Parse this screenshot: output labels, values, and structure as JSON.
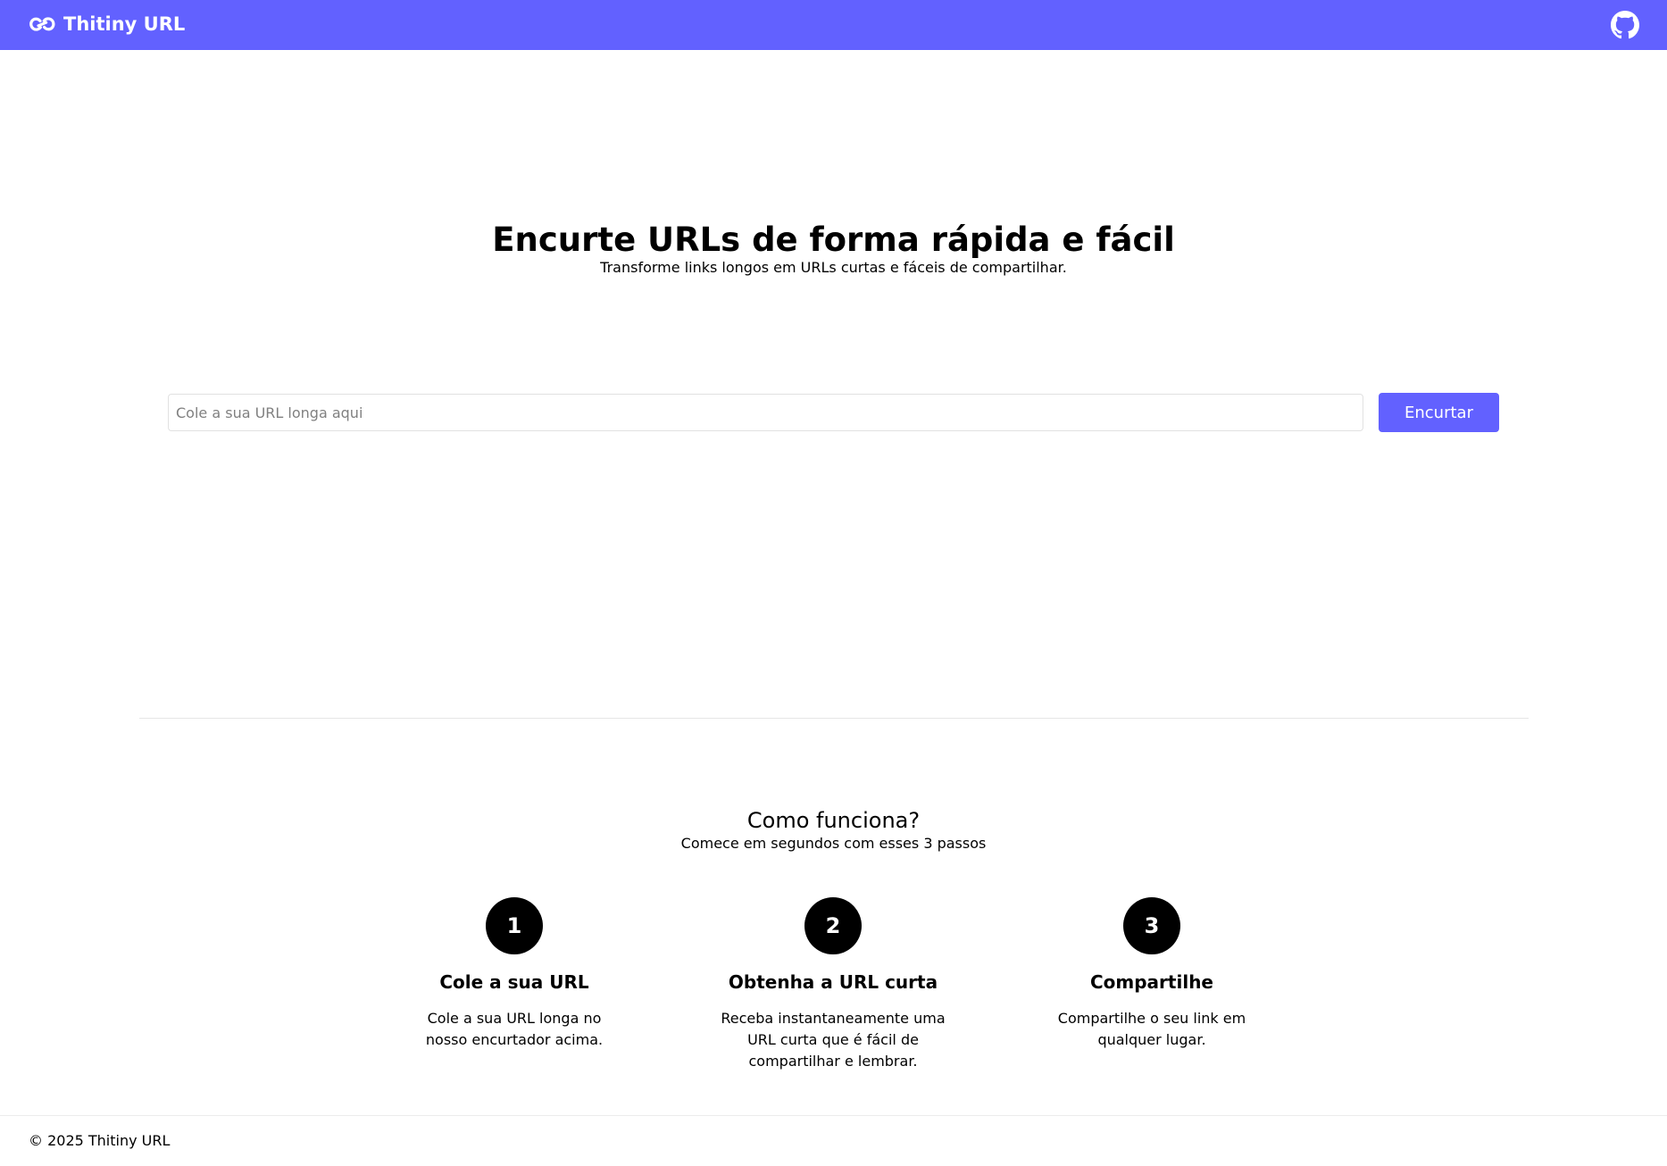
{
  "navbar": {
    "brand_icon": "link-icon",
    "brand_label": "Thitiny URL",
    "github_icon": "github-icon"
  },
  "hero": {
    "title": "Encurte URLs de forma rápida e fácil",
    "subtitle": "Transforme links longos em URLs curtas e fáceis de compartilhar."
  },
  "shortener": {
    "input_value": "",
    "input_placeholder": "Cole a sua URL longa aqui",
    "button_label": "Encurtar"
  },
  "how_it_works": {
    "title": "Como funciona?",
    "subtitle": "Comece em segundos com esses 3 passos",
    "steps": [
      {
        "number": "1",
        "title": "Cole a sua URL",
        "description": "Cole a sua URL longa no nosso encurtador acima."
      },
      {
        "number": "2",
        "title": "Obtenha a URL curta",
        "description": "Receba instantaneamente uma URL curta que é fácil de compartilhar e lembrar."
      },
      {
        "number": "3",
        "title": "Compartilhe",
        "description": "Compartilhe o seu link em qualquer lugar."
      }
    ]
  },
  "footer": {
    "copyright": "© 2025 Thitiny URL"
  },
  "colors": {
    "accent": "#6261ff",
    "step_circle": "#000000",
    "text": "#000000"
  }
}
